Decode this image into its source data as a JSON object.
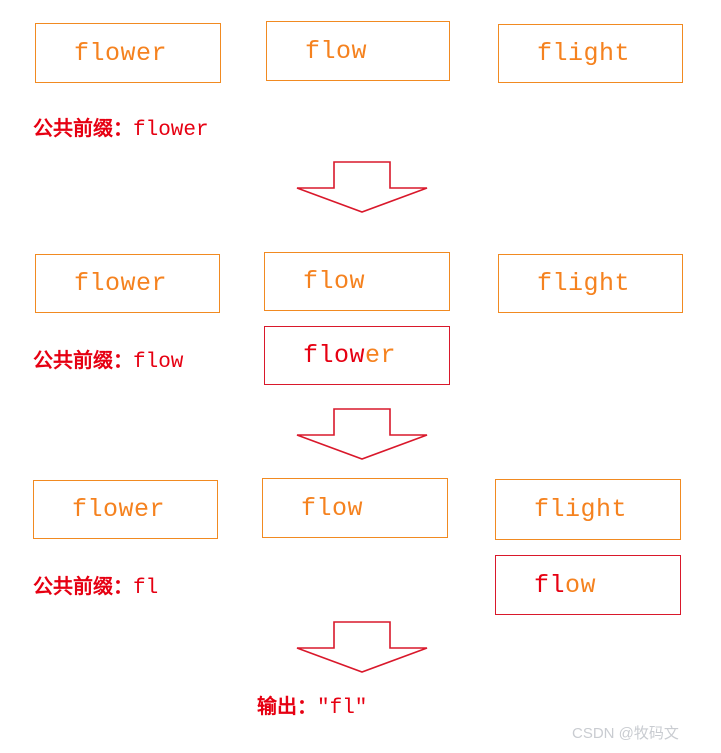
{
  "diagram": {
    "title": "Longest common prefix step diagram",
    "colors": {
      "orange": "#F5821F",
      "orange_border": "#F18A21",
      "red": "#E60012",
      "red_border": "#D9182B",
      "watermark": "#c9ccd1",
      "background": "#ffffff"
    },
    "rows": [
      {
        "id": "row-1",
        "boxes": [
          {
            "id": "row1-box-flower",
            "text": "flower",
            "prefix_part": "",
            "rest_part": "flower",
            "variant": "orange"
          },
          {
            "id": "row1-box-flow",
            "text": "flow",
            "prefix_part": "",
            "rest_part": "flow",
            "variant": "orange"
          },
          {
            "id": "row1-box-flight",
            "text": "flight",
            "prefix_part": "",
            "rest_part": "flight",
            "variant": "orange"
          }
        ],
        "caption_label": "公共前缀：",
        "caption_value": "flower"
      },
      {
        "id": "row-2",
        "boxes": [
          {
            "id": "row2-box-flower",
            "text": "flower",
            "prefix_part": "",
            "rest_part": "flower",
            "variant": "orange"
          },
          {
            "id": "row2-box-flow",
            "text": "flow",
            "prefix_part": "",
            "rest_part": "flow",
            "variant": "orange"
          },
          {
            "id": "row2-box-flight",
            "text": "flight",
            "prefix_part": "",
            "rest_part": "flight",
            "variant": "orange"
          }
        ],
        "highlight_box": {
          "id": "row2-highlight-flower",
          "prefix_part": "flow",
          "rest_part": "er",
          "variant": "red"
        },
        "caption_label": "公共前缀：",
        "caption_value": "flow"
      },
      {
        "id": "row-3",
        "boxes": [
          {
            "id": "row3-box-flower",
            "text": "flower",
            "prefix_part": "",
            "rest_part": "flower",
            "variant": "orange"
          },
          {
            "id": "row3-box-flow",
            "text": "flow",
            "prefix_part": "",
            "rest_part": "flow",
            "variant": "orange"
          },
          {
            "id": "row3-box-flight",
            "text": "flight",
            "prefix_part": "",
            "rest_part": "flight",
            "variant": "orange"
          }
        ],
        "highlight_box": {
          "id": "row3-highlight-flow",
          "prefix_part": "fl",
          "rest_part": "ow",
          "variant": "red"
        },
        "caption_label": "公共前缀：",
        "caption_value": "fl"
      }
    ],
    "arrows": [
      {
        "id": "arrow-1",
        "direction": "down"
      },
      {
        "id": "arrow-2",
        "direction": "down"
      },
      {
        "id": "arrow-3",
        "direction": "down"
      }
    ],
    "output_label": "输出：",
    "output_value": "″fl″",
    "watermark": "CSDN @牧码文"
  }
}
